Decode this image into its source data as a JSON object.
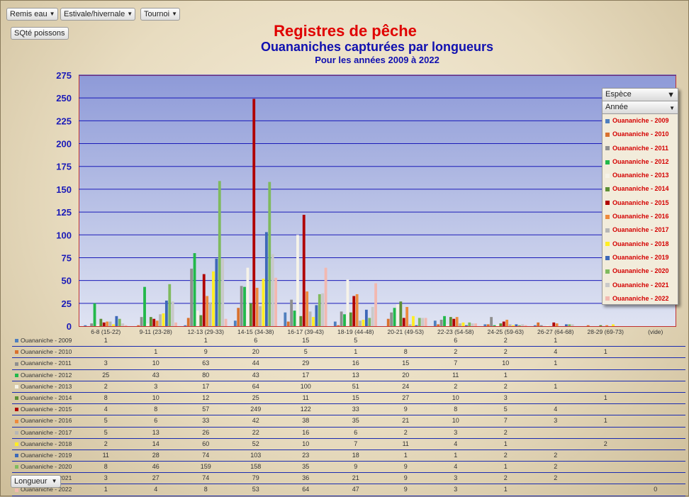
{
  "filters": {
    "remis": "Remis eau",
    "saison": "Estivale/hivernale",
    "tournoi": "Tournoi",
    "values": "SQté poissons",
    "row_field": "Longueur"
  },
  "legend": {
    "espece": "Espèce",
    "annee": "Année"
  },
  "chart_data": {
    "type": "bar",
    "title": "Registres de pêche",
    "subtitle": "Ouananiches capturées par longueurs",
    "subtitle2": "Pour les années 2009 à 2022",
    "ylim": [
      0,
      275
    ],
    "yticks": [
      0,
      25,
      50,
      75,
      100,
      125,
      150,
      175,
      200,
      225,
      250,
      275
    ],
    "categories": [
      "6-8 (15-22)",
      "9-11 (23-28)",
      "12-13 (29-33)",
      "14-15 (34-38)",
      "16-17 (39-43)",
      "18-19 (44-48)",
      "20-21 (49-53)",
      "22-23 (54-58)",
      "24-25 (59-63)",
      "26-27 (64-68)",
      "28-29 (69-73)",
      "(vide)"
    ],
    "series": [
      {
        "name": "Ouananiche - 2009",
        "color": "#4f7fbe",
        "values": [
          1,
          null,
          1,
          6,
          15,
          5,
          null,
          6,
          2,
          1,
          null,
          null
        ]
      },
      {
        "name": "Ouananiche - 2010",
        "color": "#d9712e",
        "values": [
          null,
          1,
          9,
          20,
          5,
          1,
          8,
          2,
          2,
          4,
          1,
          null
        ]
      },
      {
        "name": "Ouananiche - 2011",
        "color": "#8f8f8f",
        "values": [
          3,
          10,
          63,
          44,
          29,
          16,
          15,
          7,
          10,
          1,
          null,
          null
        ]
      },
      {
        "name": "Ouananiche - 2012",
        "color": "#22b84a",
        "values": [
          25,
          43,
          80,
          43,
          17,
          13,
          20,
          11,
          1,
          null,
          null,
          null
        ]
      },
      {
        "name": "Ouananiche - 2013",
        "color": "#f6f3e8",
        "values": [
          2,
          3,
          17,
          64,
          100,
          51,
          24,
          2,
          2,
          1,
          null,
          null
        ]
      },
      {
        "name": "Ouananiche - 2014",
        "color": "#5c8f35",
        "values": [
          8,
          10,
          12,
          25,
          11,
          15,
          27,
          10,
          3,
          null,
          1,
          null
        ]
      },
      {
        "name": "Ouananiche - 2015",
        "color": "#b00000",
        "values": [
          4,
          8,
          57,
          249,
          122,
          33,
          9,
          8,
          5,
          4,
          null,
          null
        ]
      },
      {
        "name": "Ouananiche - 2016",
        "color": "#ee8a3c",
        "values": [
          5,
          6,
          33,
          42,
          38,
          35,
          21,
          10,
          7,
          3,
          1,
          null
        ]
      },
      {
        "name": "Ouananiche - 2017",
        "color": "#b6b6b6",
        "values": [
          5,
          13,
          26,
          22,
          16,
          6,
          2,
          3,
          2,
          null,
          null,
          null
        ]
      },
      {
        "name": "Ouananiche - 2018",
        "color": "#ffee22",
        "values": [
          2,
          14,
          60,
          52,
          10,
          7,
          11,
          4,
          1,
          null,
          2,
          null
        ]
      },
      {
        "name": "Ouananiche - 2019",
        "color": "#3d68b8",
        "values": [
          11,
          28,
          74,
          103,
          23,
          18,
          1,
          1,
          2,
          2,
          null,
          null
        ]
      },
      {
        "name": "Ouananiche - 2020",
        "color": "#7fba5e",
        "values": [
          8,
          46,
          159,
          158,
          35,
          9,
          9,
          4,
          1,
          2,
          null,
          null
        ]
      },
      {
        "name": "Ouananiche - 2021",
        "color": "#c9c9c9",
        "values": [
          3,
          27,
          74,
          79,
          36,
          21,
          9,
          3,
          2,
          2,
          null,
          null
        ]
      },
      {
        "name": "Ouananiche - 2022",
        "color": "#f2b8b0",
        "values": [
          1,
          4,
          8,
          53,
          64,
          47,
          9,
          3,
          1,
          null,
          null,
          0
        ]
      }
    ]
  }
}
